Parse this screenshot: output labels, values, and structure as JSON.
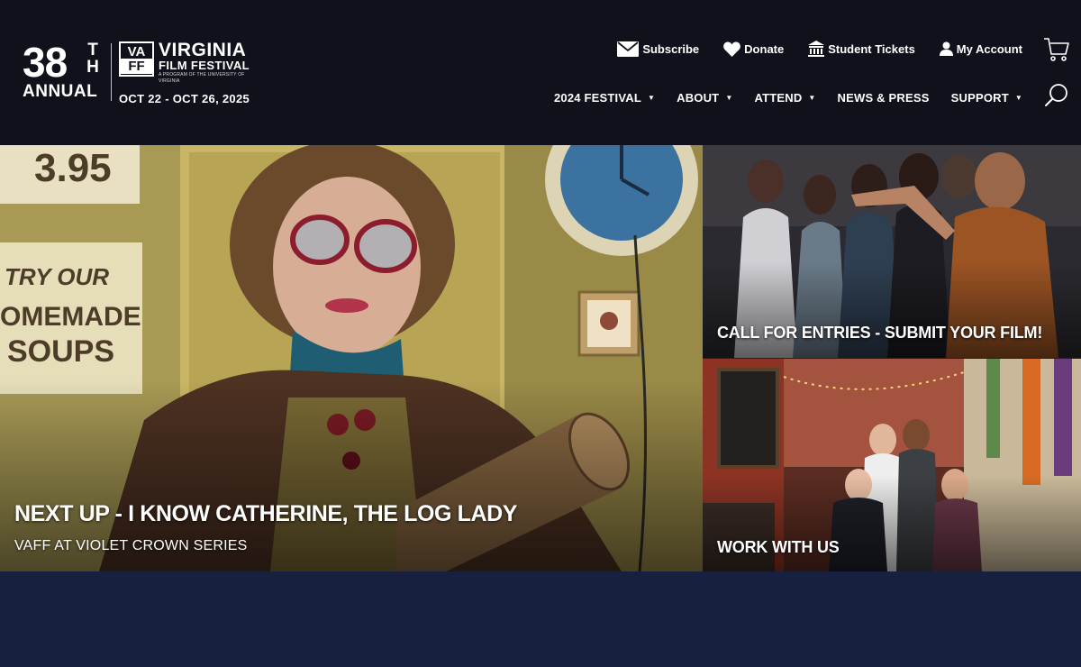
{
  "logo": {
    "number": "38",
    "suffix": "TH",
    "annual": "ANNUAL",
    "vaff_top": "VA",
    "vaff_bottom": "FF",
    "virginia": "VIRGINIA",
    "film_festival": "FILM FESTIVAL",
    "program": "A program of the University of Virginia",
    "dates": "OCT 22 - OCT 26, 2025"
  },
  "util_nav": [
    {
      "label": "Subscribe",
      "icon": "envelope-icon"
    },
    {
      "label": "Donate",
      "icon": "heart-icon"
    },
    {
      "label": "Student Tickets",
      "icon": "building-icon"
    },
    {
      "label": "My Account",
      "icon": "user-icon"
    }
  ],
  "main_nav": [
    {
      "label": "2024 FESTIVAL",
      "dropdown": true
    },
    {
      "label": "ABOUT",
      "dropdown": true
    },
    {
      "label": "ATTEND",
      "dropdown": true
    },
    {
      "label": "NEWS & PRESS",
      "dropdown": false
    },
    {
      "label": "SUPPORT",
      "dropdown": true
    }
  ],
  "caret": "▼",
  "icons": {
    "cart": "cart-icon",
    "search": "search-icon"
  },
  "hero": {
    "title": "NEXT UP - I KNOW CATHERINE, THE LOG LADY",
    "subtitle": "VAFF AT VIOLET CROWN SERIES",
    "sign_price": "3.95",
    "sign_try": "TRY OUR",
    "sign_homemade": "OMEMADE",
    "sign_soups": "SOUPS"
  },
  "tiles": [
    {
      "title": "CALL FOR ENTRIES - SUBMIT YOUR FILM!"
    },
    {
      "title": "WORK WITH US"
    }
  ],
  "colors": {
    "header_bg": "#10121b",
    "page_bg": "#18203f",
    "text": "#ffffff"
  }
}
